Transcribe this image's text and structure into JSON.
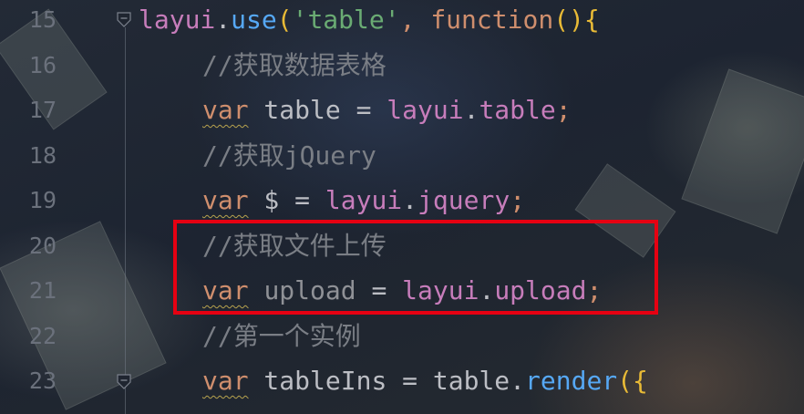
{
  "editor": {
    "lines": [
      {
        "number": "15",
        "tokens": {
          "a": "layui",
          "b": ".",
          "c": "use",
          "d": "(",
          "e": "'table'",
          "f": ", ",
          "g": "function",
          "h": "(){"
        }
      },
      {
        "number": "16",
        "comment": "//获取数据表格"
      },
      {
        "number": "17",
        "tokens": {
          "kw": "var",
          "name": " table = ",
          "obj": "layui",
          "dot": ".",
          "prop": "table",
          "end": ";"
        }
      },
      {
        "number": "18",
        "comment": "//获取jQuery"
      },
      {
        "number": "19",
        "tokens": {
          "kw": "var",
          "name": " $ = ",
          "obj": "layui",
          "dot": ".",
          "prop": "jquery",
          "end": ";"
        }
      },
      {
        "number": "20",
        "comment": "//获取文件上传"
      },
      {
        "number": "21",
        "tokens": {
          "kw": "var",
          "sp": " ",
          "name": "upload",
          "eq": " = ",
          "obj": "layui",
          "dot": ".",
          "prop": "upload",
          "end": ";"
        }
      },
      {
        "number": "22",
        "comment": "//第一个实例"
      },
      {
        "number": "23",
        "tokens": {
          "kw": "var",
          "name": " tableIns = table.",
          "method": "render",
          "paren": "({"
        }
      }
    ]
  },
  "theme": {
    "keyword": "#cf8e6d",
    "comment": "#7a7e85",
    "string": "#6aab73",
    "identifier": "#c77dbb",
    "method": "#56a8f5",
    "highlight_border": "#e60012"
  },
  "icons": {
    "fold_line_15": "fold-open-icon",
    "fold_line_23": "fold-open-icon"
  }
}
